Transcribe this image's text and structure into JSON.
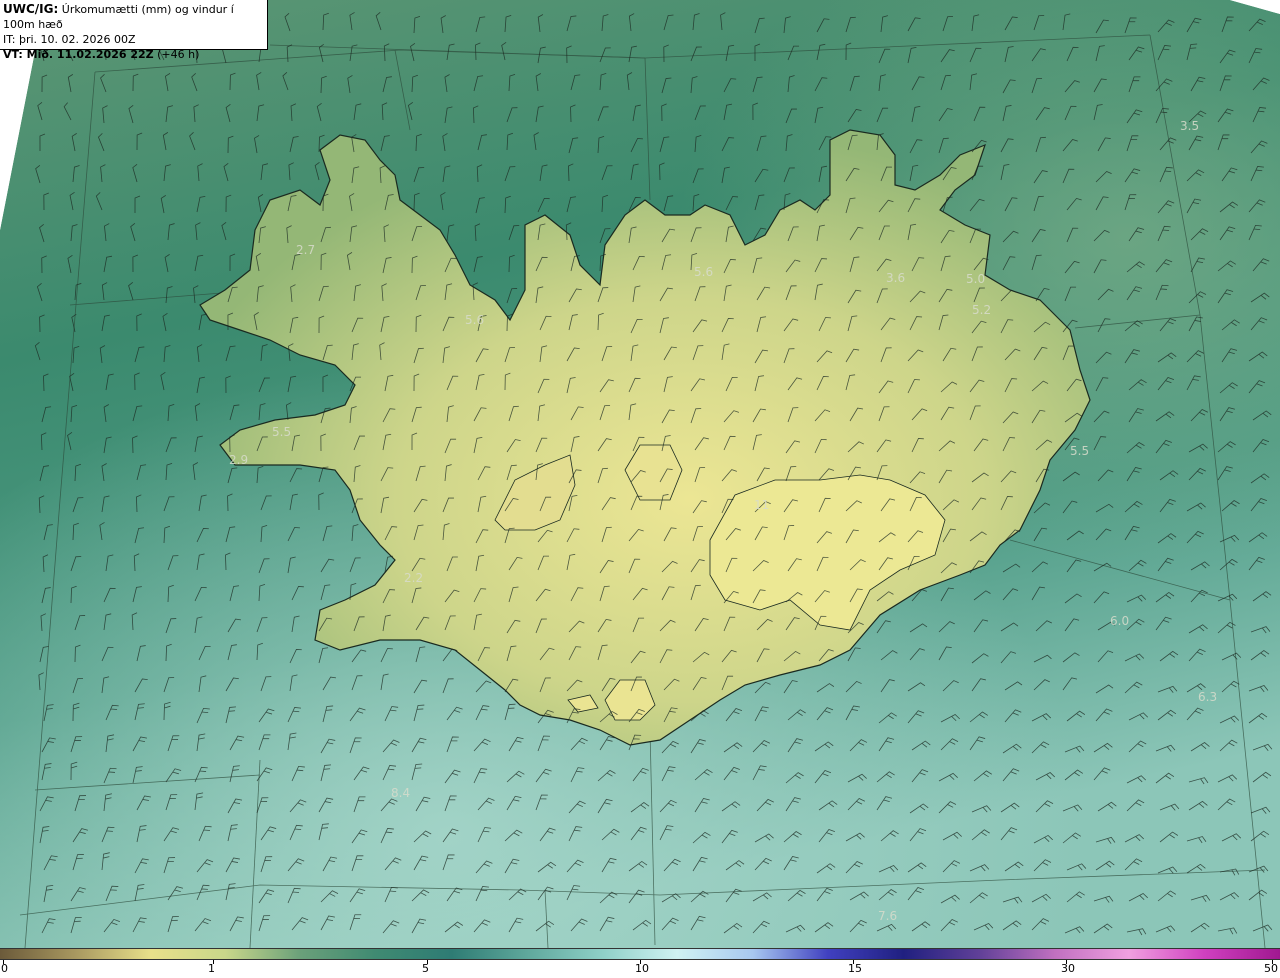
{
  "header": {
    "title_bold": "UWC/IG:",
    "title_rest": " Úrkomumætti (mm) og vindur í 100m hæð",
    "it_line": "IT: þri. 10. 02. 2026 00Z",
    "vt_bold": "VT: Mið. 11.02.2026 22Z",
    "vt_rest": " (+46 h)"
  },
  "colorbar": {
    "ticks": [
      "0",
      "1",
      "5",
      "10",
      "15",
      "30",
      "50"
    ],
    "colors": [
      "#6b5a3a",
      "#a89860",
      "#e8e08a",
      "#c9d78a",
      "#6aa07a",
      "#3f8a72",
      "#2e7c74",
      "#5fa89c",
      "#8fd0c8",
      "#d0f2f2",
      "#a8c8f0",
      "#4040c0",
      "#202080",
      "#604098",
      "#c070c0",
      "#f0a0e0",
      "#d040c0",
      "#a01890"
    ]
  },
  "map_values": [
    "2.7",
    "5.6",
    "5.6",
    "3.6",
    "5.0",
    "5.2",
    "3.5",
    "5.5",
    "2.9",
    "5.5",
    "11",
    "2.2",
    "6.0",
    "6.3",
    "8.4",
    "7.6"
  ],
  "colors": {
    "sea_dark": "#2f7e6c",
    "sea_mid": "#4a9078",
    "sea_light": "#86bfae",
    "land_low": "#a9c27e",
    "land_high": "#e6e092",
    "coast": "#1a2a20"
  }
}
